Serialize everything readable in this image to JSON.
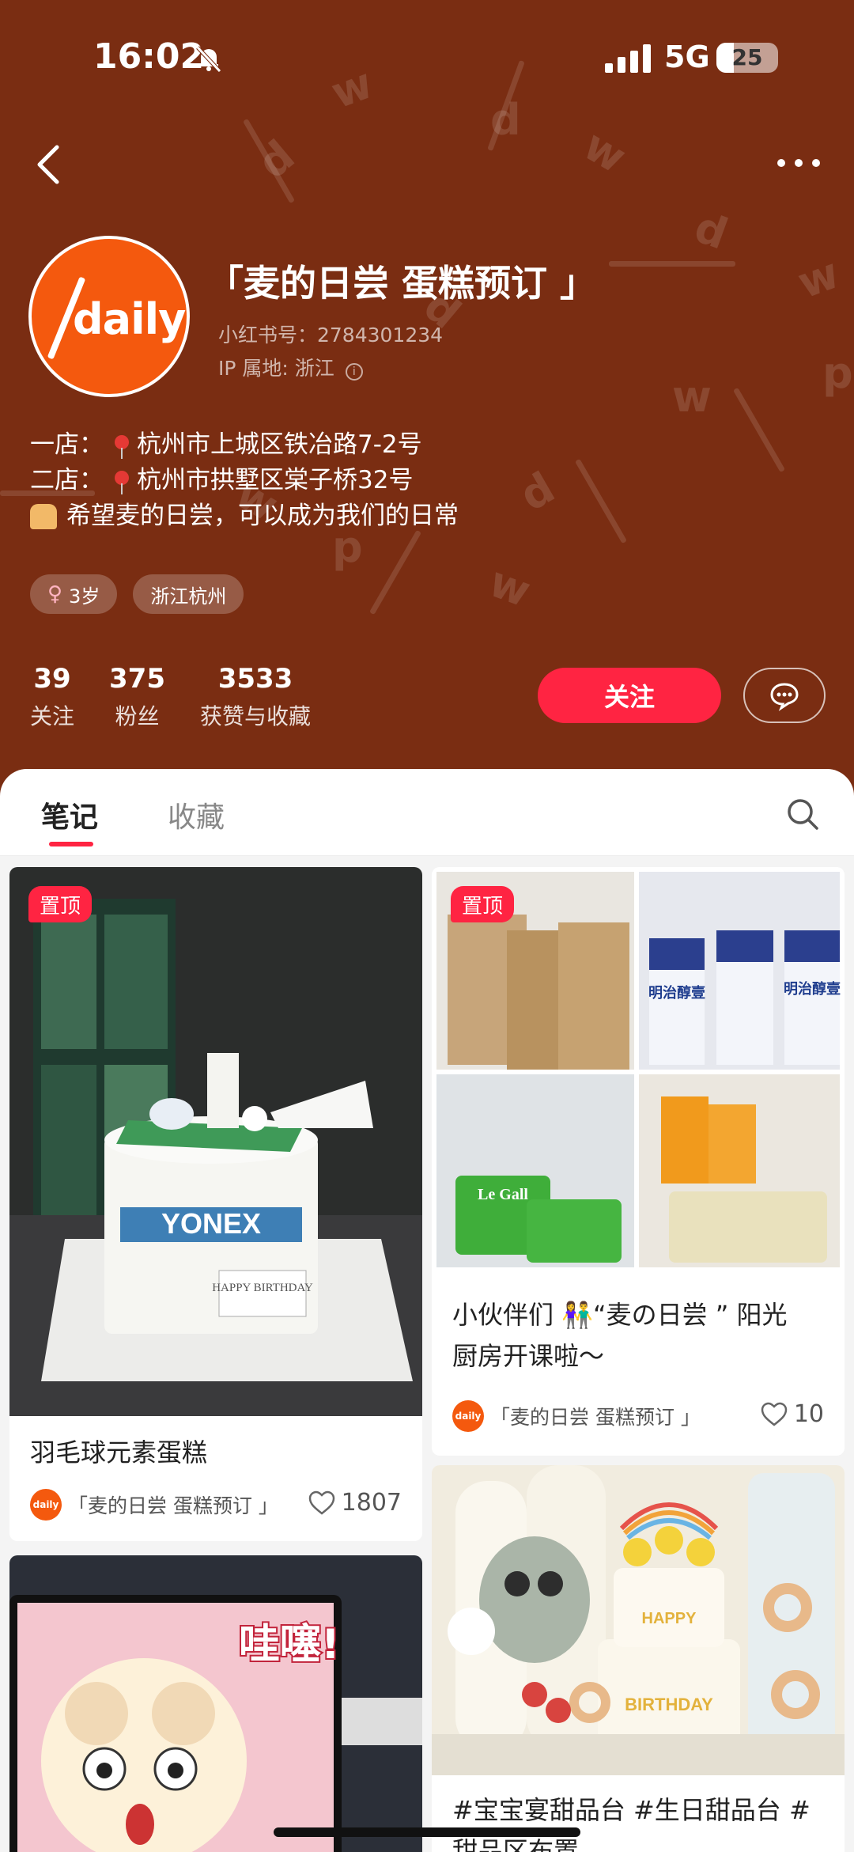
{
  "status": {
    "time": "16:02",
    "network": "5G",
    "battery": "25"
  },
  "profile": {
    "avatar_text": "daily",
    "name": "「麦的日尝 蛋糕预订 」",
    "red_id": "小红书号：2784301234",
    "ip": "IP 属地: 浙江",
    "bio": {
      "line1_prefix": "一店：",
      "line1_addr": "杭州市上城区铁冶路7-2号",
      "line2_prefix": "二店：",
      "line2_addr": "杭州市拱墅区棠子桥32号",
      "line3": "希望麦的日尝，可以成为我们的日常"
    },
    "tags": [
      "3岁",
      "浙江杭州"
    ],
    "stats": [
      {
        "num": "39",
        "label": "关注"
      },
      {
        "num": "375",
        "label": "粉丝"
      },
      {
        "num": "3533",
        "label": "获赞与收藏"
      }
    ],
    "follow_label": "关注"
  },
  "tabs": {
    "notes": "笔记",
    "collect": "收藏"
  },
  "feed": {
    "badge": "置顶",
    "post1": {
      "title": "羽毛球元素蛋糕",
      "author": "「麦的日尝 蛋糕预订 」",
      "likes": "1807",
      "cake_text": "YONEX",
      "card_text": "HAPPY BIRTHDAY"
    },
    "post2": {
      "title_line1": "小伙伴们 👫“麦の日尝 ” 阳光",
      "title_line2": "厨房开课啦～",
      "author": "「麦的日尝 蛋糕预订 」",
      "likes": "10",
      "boxes": [
        "明治醇壹",
        "明治醇壹"
      ],
      "butter": "Le Gall"
    },
    "post3": {
      "overlay_text": "哇噻!"
    },
    "post4": {
      "title_line1": "#宝宝宴甜品台 #生日甜品台 #",
      "title_line2": "甜品区布置",
      "cake_text": "HAPPY",
      "cake_text2": "BIRTHDAY"
    }
  },
  "colors": {
    "header_bg": "#7a2d12",
    "accent": "#ff2442",
    "brand": "#f4590e"
  }
}
